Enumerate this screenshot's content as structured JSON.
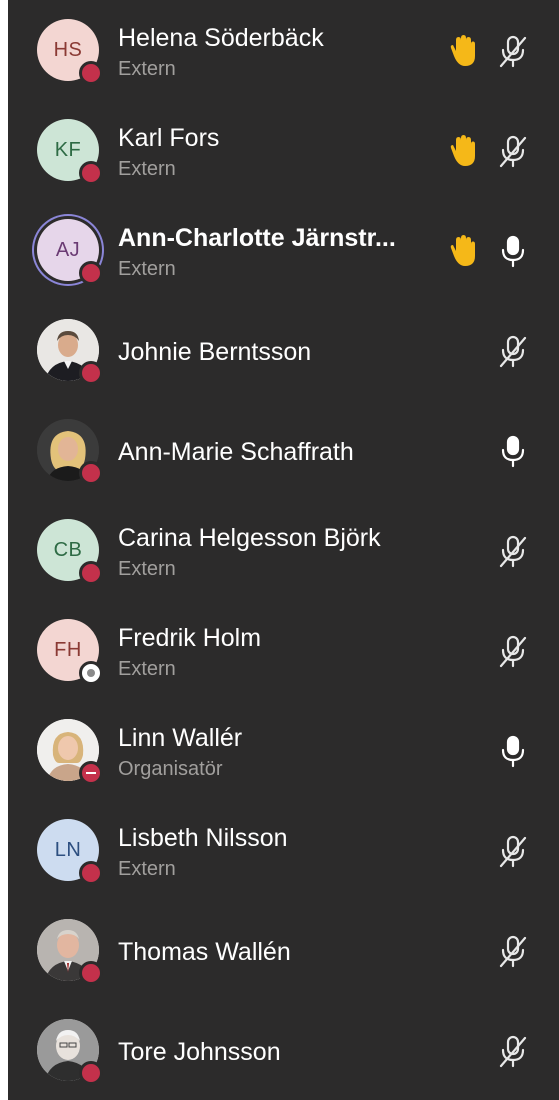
{
  "participants": [
    {
      "initials": "HS",
      "name": "Helena Söderbäck",
      "role": "Extern",
      "avatar_bg": "#f3d6d2",
      "avatar_fg": "#8a3a34",
      "presence": "busy",
      "hand": true,
      "mic": "muted-icon"
    },
    {
      "initials": "KF",
      "name": "Karl Fors",
      "role": "Extern",
      "avatar_bg": "#cde5d6",
      "avatar_fg": "#2e6b45",
      "presence": "busy",
      "hand": true,
      "mic": "muted-icon"
    },
    {
      "initials": "AJ",
      "name": "Ann-Charlotte Järnstr...",
      "role": "Extern",
      "avatar_bg": "#e6d6ea",
      "avatar_fg": "#6b3c74",
      "presence": "busy",
      "hand": true,
      "mic": "mic-on-icon"
    },
    {
      "initials": "",
      "name": "Johnie Berntsson",
      "role": "",
      "photo": "man-photo",
      "presence": "busy",
      "hand": false,
      "mic": "muted-icon"
    },
    {
      "initials": "",
      "name": "Ann-Marie Schaffrath",
      "role": "",
      "photo": "woman-photo",
      "presence": "busy",
      "hand": false,
      "mic": "mic-on-icon"
    },
    {
      "initials": "CB",
      "name": "Carina Helgesson Björk",
      "role": "Extern",
      "avatar_bg": "#cde5d6",
      "avatar_fg": "#2e6b45",
      "presence": "busy",
      "hand": false,
      "mic": "muted-icon"
    },
    {
      "initials": "FH",
      "name": "Fredrik Holm",
      "role": "Extern",
      "avatar_bg": "#f3d6d2",
      "avatar_fg": "#8a3a34",
      "presence": "offline",
      "hand": false,
      "mic": "muted-icon"
    },
    {
      "initials": "",
      "name": "Linn Wallér",
      "role": "Organisatör",
      "photo": "woman-photo",
      "presence": "dnd",
      "hand": false,
      "mic": "mic-on-icon"
    },
    {
      "initials": "LN",
      "name": "Lisbeth Nilsson",
      "role": "Extern",
      "avatar_bg": "#cddcf0",
      "avatar_fg": "#2d4f80",
      "presence": "busy",
      "hand": false,
      "mic": "muted-icon"
    },
    {
      "initials": "",
      "name": "Thomas Wallén",
      "role": "",
      "photo": "man-photo",
      "presence": "busy",
      "hand": false,
      "mic": "muted-icon"
    },
    {
      "initials": "",
      "name": "Tore Johnsson",
      "role": "",
      "photo": "man-photo",
      "presence": "busy",
      "hand": false,
      "mic": "muted-icon"
    }
  ],
  "colors": {
    "panel": "#2c2b2b",
    "hand": "#f5b818",
    "presence_busy": "#c4314b",
    "ring": "#8b86d8"
  }
}
